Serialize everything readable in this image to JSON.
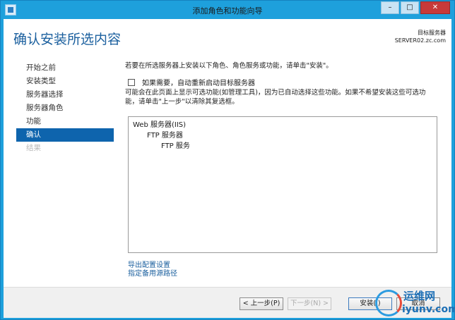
{
  "window": {
    "title": "添加角色和功能向导"
  },
  "header": {
    "page_title": "确认安装所选内容",
    "target_label": "目标服务器",
    "target_server": "SERVER02.zc.com"
  },
  "nav": {
    "items": [
      {
        "label": "开始之前",
        "state": "normal"
      },
      {
        "label": "安装类型",
        "state": "normal"
      },
      {
        "label": "服务器选择",
        "state": "normal"
      },
      {
        "label": "服务器角色",
        "state": "normal"
      },
      {
        "label": "功能",
        "state": "normal"
      },
      {
        "label": "确认",
        "state": "active"
      },
      {
        "label": "结果",
        "state": "disabled"
      }
    ]
  },
  "main": {
    "intro": "若要在所选服务器上安装以下角色、角色服务或功能，请单击\"安装\"。",
    "restart_checkbox_label": "如果需要，自动重新启动目标服务器",
    "note": "可能会在此页面上显示可选功能(如管理工具)，因为已自动选择这些功能。如果不希望安装这些可选功能，请单击\"上一步\"以清除其复选框。",
    "selection": [
      {
        "label": "Web 服务器(IIS)",
        "level": 1
      },
      {
        "label": "FTP 服务器",
        "level": 2
      },
      {
        "label": "FTP 服务",
        "level": 3
      }
    ],
    "links": {
      "export": "导出配置设置",
      "source_path": "指定备用源路径"
    }
  },
  "footer": {
    "prev": "< 上一步(P)",
    "next": "下一步(N) >",
    "install": "安装(I)",
    "cancel": "取消"
  },
  "watermark": {
    "logo_text": "运维网",
    "domain": "iyunv.com"
  },
  "colors": {
    "titlebar": "#1ea0dc",
    "accent": "#0e64ad",
    "title_text": "#1a5f9e"
  }
}
